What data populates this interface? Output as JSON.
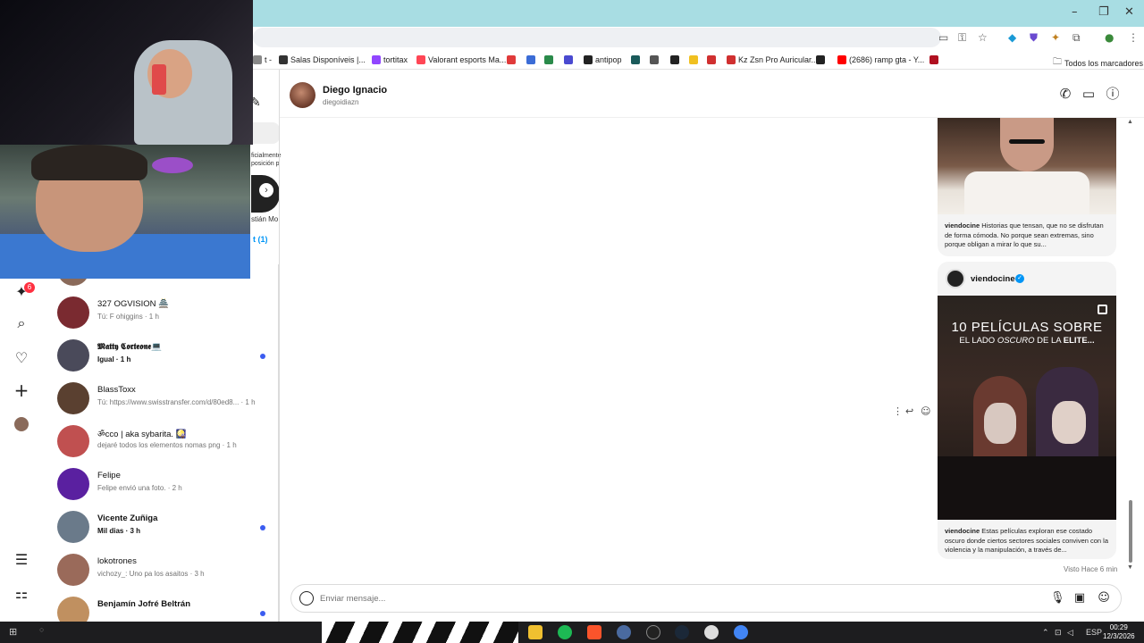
{
  "browser": {
    "bookmarks": [
      {
        "label": "t -",
        "color": "#888888"
      },
      {
        "label": "Salas Disponíveis |...",
        "color": "#333333"
      },
      {
        "label": "tortitax",
        "color": "#9146ff"
      },
      {
        "label": "Valorant esports Ma...",
        "color": "#ff4655"
      },
      {
        "label": "",
        "color": "#e03a3a"
      },
      {
        "label": "",
        "color": "#3b6cd6"
      },
      {
        "label": "",
        "color": "#2a8a4a"
      },
      {
        "label": "",
        "color": "#4a4ad0"
      },
      {
        "label": "antipop",
        "color": "#222222"
      },
      {
        "label": "",
        "color": "#1a5a5a"
      },
      {
        "label": "",
        "color": "#555555"
      },
      {
        "label": "",
        "color": "#222222"
      },
      {
        "label": "",
        "color": "#f0c020"
      },
      {
        "label": "",
        "color": "#d03030"
      },
      {
        "label": "Kz Zsn Pro Auricular...",
        "color": "#d03030"
      },
      {
        "label": "",
        "color": "#222222"
      },
      {
        "label": "(2686) ramp gta - Y...",
        "color": "#ff0000"
      },
      {
        "label": "",
        "color": "#b01020"
      }
    ],
    "all_bookmarks_label": "Todos los marcadores",
    "window_controls": {
      "minimize": "–",
      "restore": "❐",
      "close": "✕"
    }
  },
  "stories": {
    "fragment_text": "ficialmente posición p",
    "name_fragment": "stián Mo",
    "requests_fragment": "t (1)"
  },
  "rail": {
    "badge_count": "6",
    "icons": [
      "messenger-icon",
      "search-icon",
      "heart-icon",
      "plus-icon",
      "profile-avatar",
      "menu-icon",
      "grid-icon"
    ]
  },
  "conversations": [
    {
      "name": "",
      "snippet": "...",
      "time": "",
      "bold": false,
      "unread": false,
      "color": "#8a6a5a"
    },
    {
      "name": "327 OGVISION 🏯",
      "snippet": "Tú: F ohiggins · 1 h",
      "bold": false,
      "unread": false,
      "color": "#7a2a30"
    },
    {
      "name": "𝕸𝖆𝖙𝖙𝖞 𝕮𝖔𝖗𝖙𝖊𝖔𝖓𝖊💻",
      "snippet": "Igual · 1 h",
      "bold": true,
      "unread": true,
      "color": "#4a4a5a"
    },
    {
      "name": "BlassToxx",
      "snippet": "Tú: https://www.swisstransfer.com/d/80ed8... · 1 h",
      "bold": false,
      "unread": false,
      "color": "#5a4030"
    },
    {
      "name": "ॐcco | aka sybarita. 🎑",
      "snippet": "dejaré todos los elementos nomas png · 1 h",
      "bold": false,
      "unread": false,
      "color": "#c05050"
    },
    {
      "name": "Felipe",
      "snippet": "Felipe envió una foto. · 2 h",
      "bold": false,
      "unread": false,
      "color": "#5a20a0"
    },
    {
      "name": "Vicente Zuñiga",
      "snippet": "Mil dias · 3 h",
      "bold": true,
      "unread": true,
      "color": "#6a7a8a"
    },
    {
      "name": "lokotrones",
      "snippet": "vichozy_: Uno pa los asaitos · 3 h",
      "bold": false,
      "unread": false,
      "color": "#9a6a5a"
    },
    {
      "name": "Benjamín Jofré Beltrán",
      "snippet": "",
      "bold": true,
      "unread": true,
      "color": "#c09060"
    }
  ],
  "chat": {
    "name": "Diego Ignacio",
    "username": "diegoidiazn",
    "post1_caption_user": "viendocine",
    "post1_caption": "Historias que tensan, que no se disfrutan de forma cómoda. No porque sean extremas, sino porque obligan a mirar lo que su...",
    "post2_user": "viendocine",
    "post2_title_line1": "10 PELÍCULAS SOBRE",
    "post2_title_line2_a": "EL LADO ",
    "post2_title_line2_b": "OSCURO",
    "post2_title_line2_c": " DE LA ",
    "post2_title_line2_d": "ELITE...",
    "post2_caption_user": "viendocine",
    "post2_caption": "Estas películas exploran ese costado oscuro donde ciertos sectores sociales conviven con la violencia y la manipulación, a través de...",
    "seen": "Visto Hace 6 min",
    "composer_placeholder": "Enviar mensaje..."
  },
  "taskbar": {
    "time": "00:29",
    "date": "12/3/2026",
    "lang": "ESP"
  }
}
